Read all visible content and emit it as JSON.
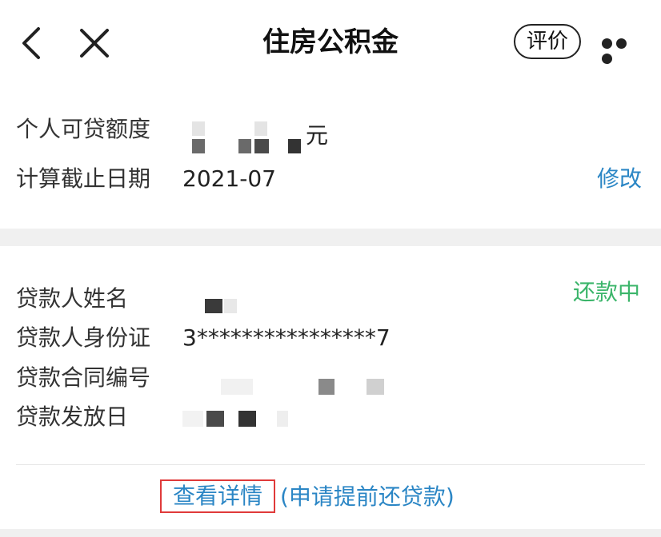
{
  "header": {
    "title": "住房公积金",
    "rate_label": "评价",
    "back_icon": "chevron-left-icon",
    "close_icon": "close-icon",
    "more_icon": "more-horizontal-icon"
  },
  "quota": {
    "amount_label": "个人可贷额度",
    "amount_unit": "元",
    "date_label": "计算截止日期",
    "date_value": "2021-07",
    "edit_label": "修改"
  },
  "loan": {
    "status": "还款中",
    "borrower_name_label": "贷款人姓名",
    "borrower_id_label": "贷款人身份证",
    "borrower_id_value": "3****************7",
    "contract_no_label": "贷款合同编号",
    "issue_date_label": "贷款发放日"
  },
  "actions": {
    "view_details": "查看详情",
    "apply_prepay": "(申请提前还贷款)"
  },
  "colors": {
    "link": "#2b86c5",
    "status": "#3bb56a",
    "highlight_border": "#e03a3a",
    "band": "#f0f0f0"
  }
}
